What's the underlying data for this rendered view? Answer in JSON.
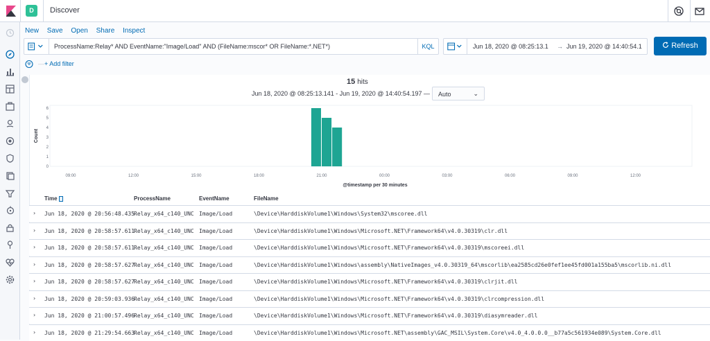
{
  "header": {
    "space_initial": "D",
    "app_title": "Discover"
  },
  "menu": {
    "new": "New",
    "save": "Save",
    "open": "Open",
    "share": "Share",
    "inspect": "Inspect"
  },
  "query": {
    "text": "ProcessName:Relay* AND EventName:\"Image/Load\" AND (FileName:mscor* OR FileName:*.NET*)",
    "language": "KQL"
  },
  "time": {
    "start": "Jun 18, 2020 @ 08:25:13.1",
    "end": "Jun 19, 2020 @ 14:40:54.1",
    "arrow": "→"
  },
  "refresh_label": "Refresh",
  "filter": {
    "dash": "—",
    "add_label": "+ Add filter"
  },
  "results": {
    "hits_count": "15",
    "hits_label": "hits",
    "range": "Jun 18, 2020 @ 08:25:13.141 - Jun 19, 2020 @ 14:40:54.197 —",
    "interval": "Auto"
  },
  "chart_data": {
    "type": "bar",
    "ylabel": "Count",
    "xlabel": "@timestamp per 30 minutes",
    "yticks": [
      "0",
      "1",
      "2",
      "3",
      "4",
      "5",
      "6"
    ],
    "xticks": [
      "09:00",
      "12:00",
      "15:00",
      "18:00",
      "21:00",
      "00:00",
      "03:00",
      "06:00",
      "09:00",
      "12:00"
    ],
    "categories": [
      "20:30",
      "21:00",
      "21:30"
    ],
    "values": [
      6,
      5,
      4
    ],
    "ylim": [
      0,
      6
    ],
    "color": "#1ea593"
  },
  "table": {
    "columns": [
      "Time",
      "ProcessName",
      "EventName",
      "FileName"
    ],
    "rows": [
      {
        "time": "Jun 18, 2020 @ 20:56:48.435",
        "process": "Relay_x64_c140_UNC",
        "event": "Image/Load",
        "file": "\\Device\\HarddiskVolume1\\Windows\\System32\\mscoree.dll"
      },
      {
        "time": "Jun 18, 2020 @ 20:58:57.611",
        "process": "Relay_x64_c140_UNC",
        "event": "Image/Load",
        "file": "\\Device\\HarddiskVolume1\\Windows\\Microsoft.NET\\Framework64\\v4.0.30319\\clr.dll"
      },
      {
        "time": "Jun 18, 2020 @ 20:58:57.611",
        "process": "Relay_x64_c140_UNC",
        "event": "Image/Load",
        "file": "\\Device\\HarddiskVolume1\\Windows\\Microsoft.NET\\Framework64\\v4.0.30319\\mscoreei.dll"
      },
      {
        "time": "Jun 18, 2020 @ 20:58:57.627",
        "process": "Relay_x64_c140_UNC",
        "event": "Image/Load",
        "file": "\\Device\\HarddiskVolume1\\Windows\\assembly\\NativeImages_v4.0.30319_64\\mscorlib\\ea2585cd26e0fef1ee45fd001a155ba5\\mscorlib.ni.dll"
      },
      {
        "time": "Jun 18, 2020 @ 20:58:57.627",
        "process": "Relay_x64_c140_UNC",
        "event": "Image/Load",
        "file": "\\Device\\HarddiskVolume1\\Windows\\Microsoft.NET\\Framework64\\v4.0.30319\\clrjit.dll"
      },
      {
        "time": "Jun 18, 2020 @ 20:59:03.936",
        "process": "Relay_x64_c140_UNC",
        "event": "Image/Load",
        "file": "\\Device\\HarddiskVolume1\\Windows\\Microsoft.NET\\Framework64\\v4.0.30319\\clrcompression.dll"
      },
      {
        "time": "Jun 18, 2020 @ 21:00:57.496",
        "process": "Relay_x64_c140_UNC",
        "event": "Image/Load",
        "file": "\\Device\\HarddiskVolume1\\Windows\\Microsoft.NET\\Framework64\\v4.0.30319\\diasymreader.dll"
      },
      {
        "time": "Jun 18, 2020 @ 21:29:54.663",
        "process": "Relay_x64_c140_UNC",
        "event": "Image/Load",
        "file": "\\Device\\HarddiskVolume1\\Windows\\Microsoft.NET\\assembly\\GAC_MSIL\\System.Core\\v4.0_4.0.0.0__b77a5c561934e089\\System.Core.dll"
      }
    ]
  }
}
